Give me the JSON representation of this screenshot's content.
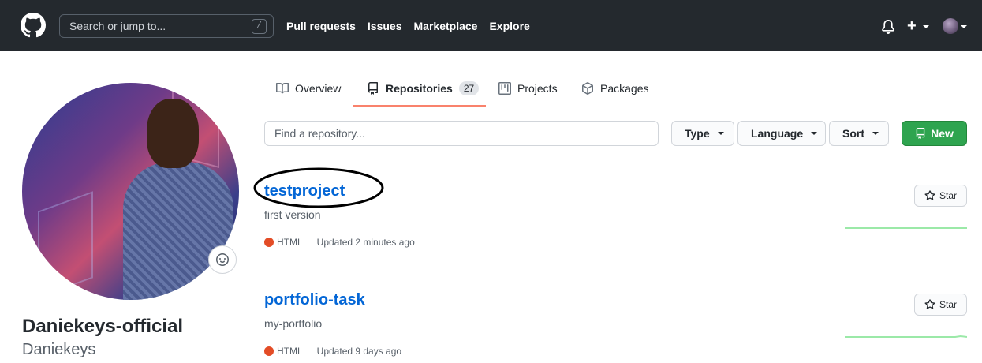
{
  "header": {
    "search_placeholder": "Search or jump to...",
    "search_shortcut": "/",
    "nav": [
      "Pull requests",
      "Issues",
      "Marketplace",
      "Explore"
    ],
    "plus_label": "+"
  },
  "tabs": [
    {
      "label": "Overview",
      "icon": "book-icon",
      "active": false
    },
    {
      "label": "Repositories",
      "icon": "repo-icon",
      "active": true,
      "count": "27"
    },
    {
      "label": "Projects",
      "icon": "project-icon",
      "active": false
    },
    {
      "label": "Packages",
      "icon": "package-icon",
      "active": false
    }
  ],
  "profile": {
    "full_name": "Daniekeys-official",
    "username": "Daniekeys"
  },
  "filters": {
    "find_placeholder": "Find a repository...",
    "type_label": "Type",
    "language_label": "Language",
    "sort_label": "Sort",
    "new_label": "New"
  },
  "repos": [
    {
      "name": "testproject",
      "description": "first version",
      "language": "HTML",
      "updated": "Updated 2 minutes ago",
      "star_label": "Star"
    },
    {
      "name": "portfolio-task",
      "description": "my-portfolio",
      "language": "HTML",
      "updated": "Updated 9 days ago",
      "star_label": "Star"
    }
  ],
  "colors": {
    "header_bg": "#24292e",
    "link": "#0366d6",
    "active_tab_underline": "#f9826c",
    "new_button": "#2ea44f",
    "html_language": "#e34c26"
  }
}
